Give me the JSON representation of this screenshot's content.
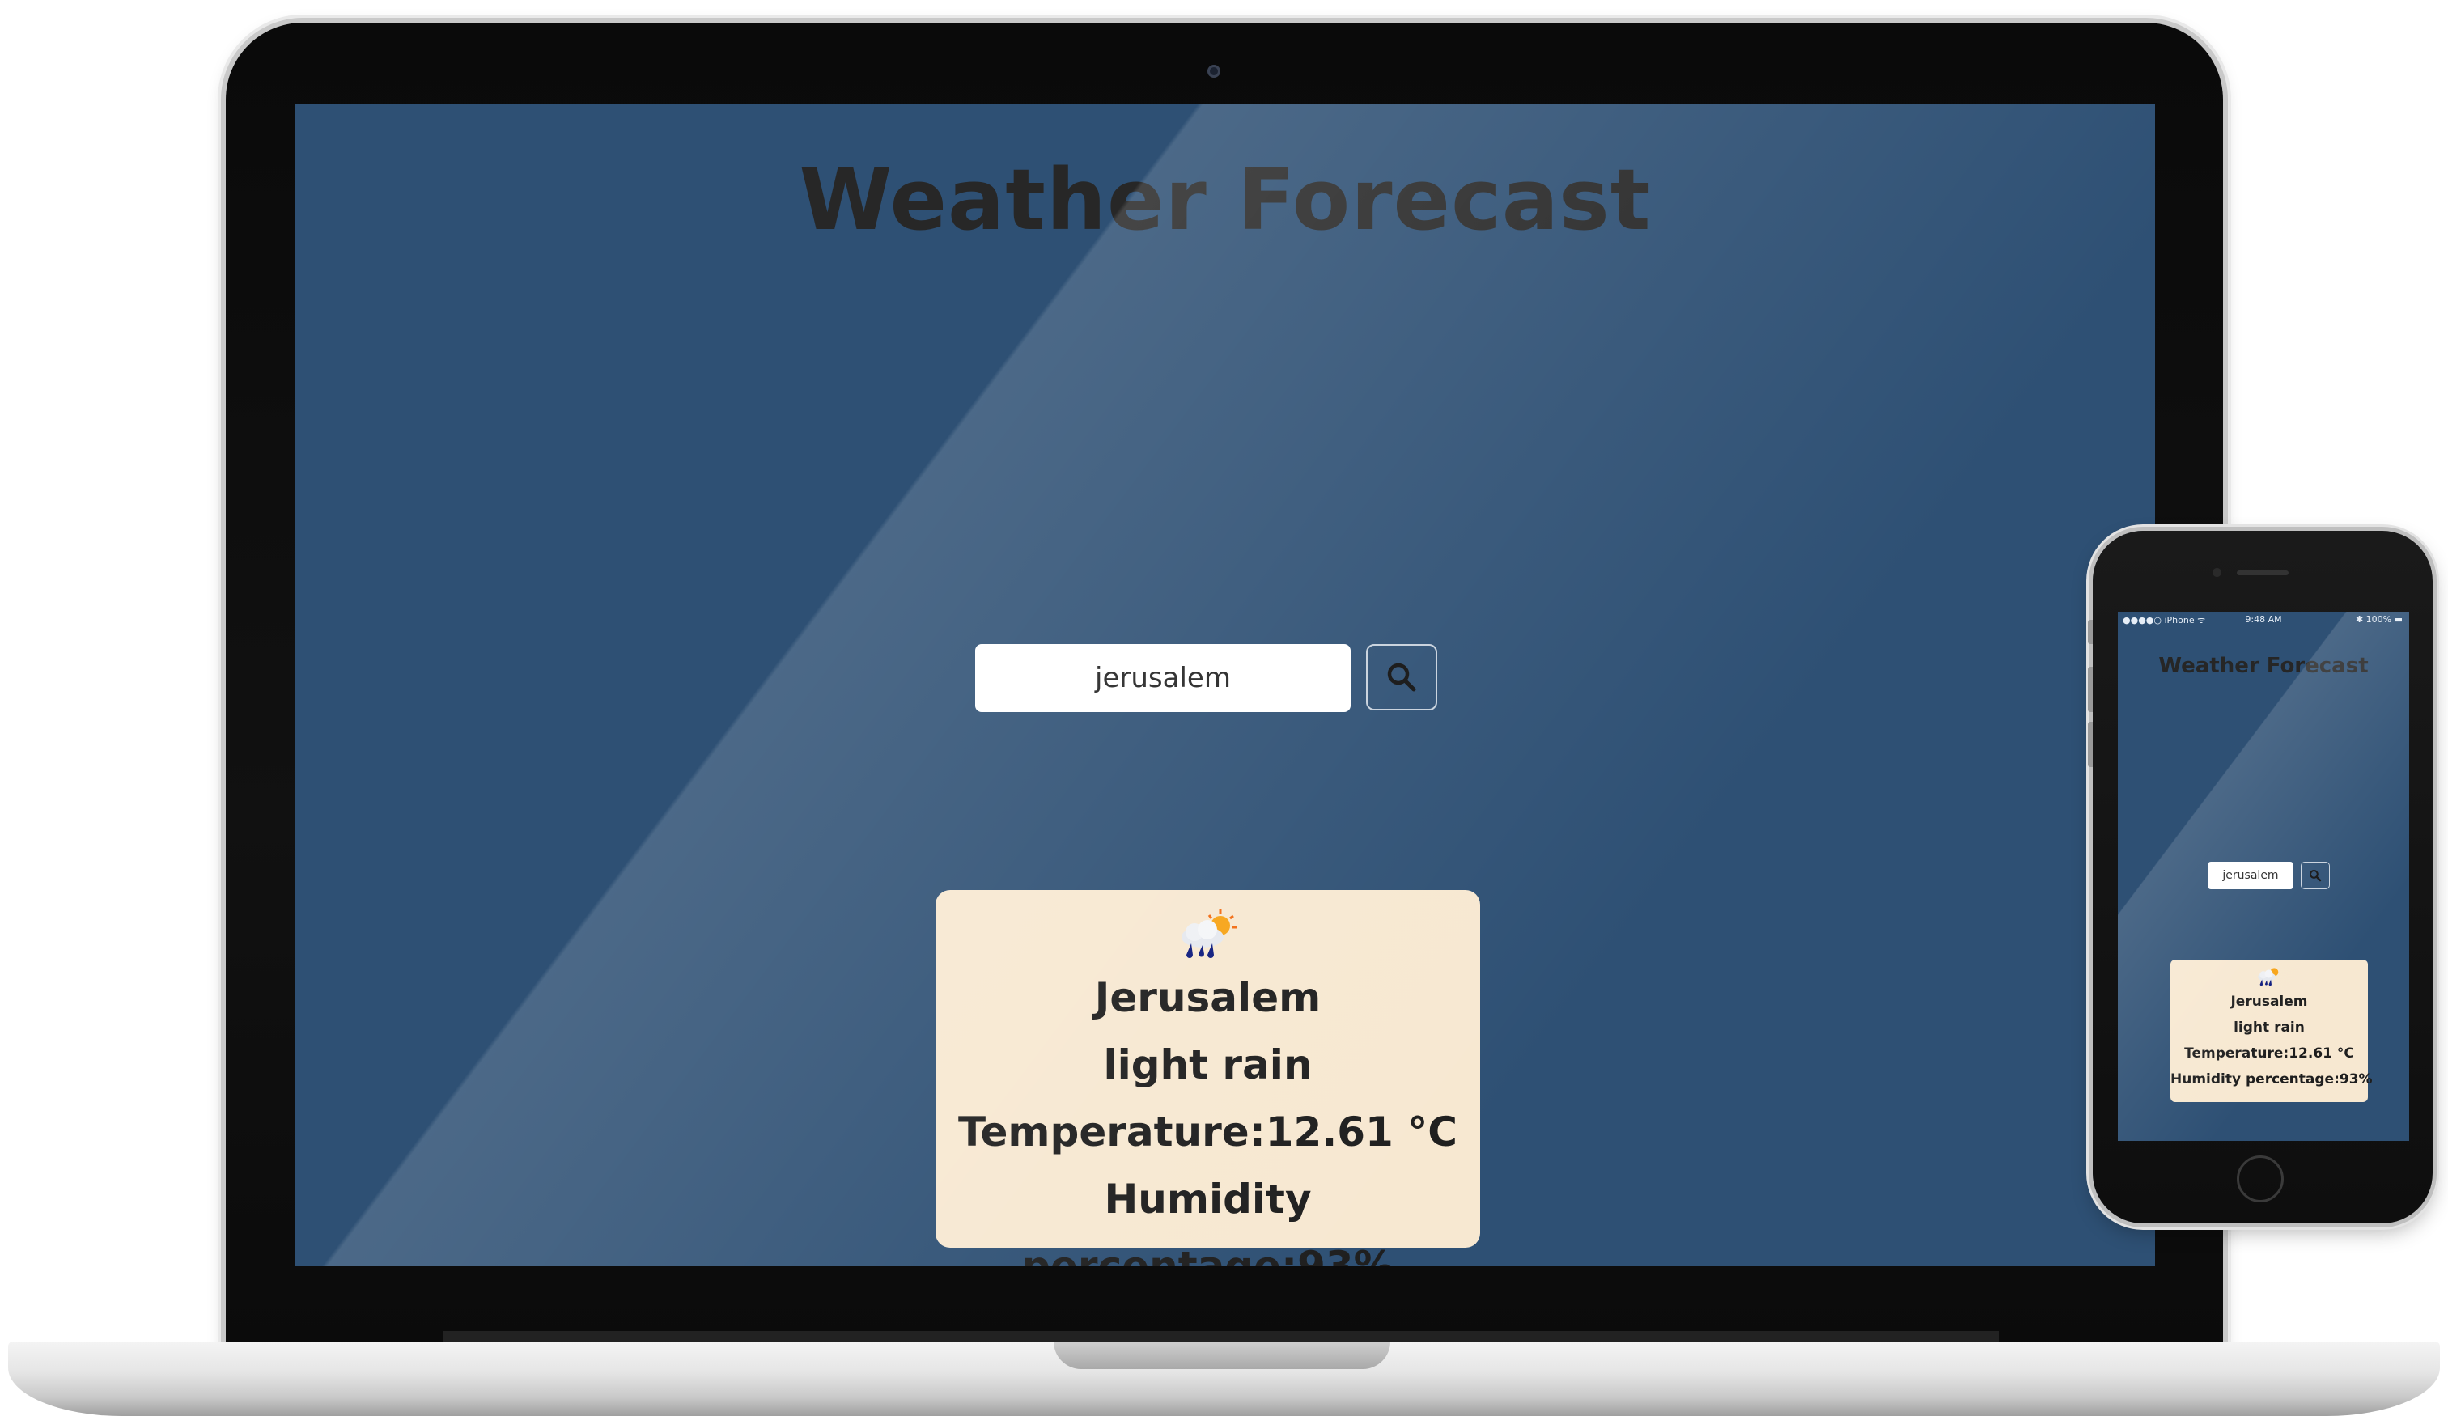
{
  "app": {
    "title": "Weather Forecast",
    "search_value": "jerusalem"
  },
  "icons": {
    "search_button": "search-icon",
    "weather": "rain-cloud-sun-icon"
  },
  "weather_card": {
    "city": "Jerusalem",
    "description": "light rain",
    "temperature": "Temperature:12.61 °C",
    "humidity": "Humidity percentage:93%"
  },
  "phone_card": {
    "temperature": "Temperature:12.61 °C"
  },
  "phone_status": {
    "carrier": "●●●●○ iPhone ᯤ",
    "time": "9:48 AM",
    "battery": "✱ 100% ▬"
  },
  "colors": {
    "screen_background": "#2e5074",
    "card_background": "#f7e8d1",
    "title_text": "#272727"
  }
}
